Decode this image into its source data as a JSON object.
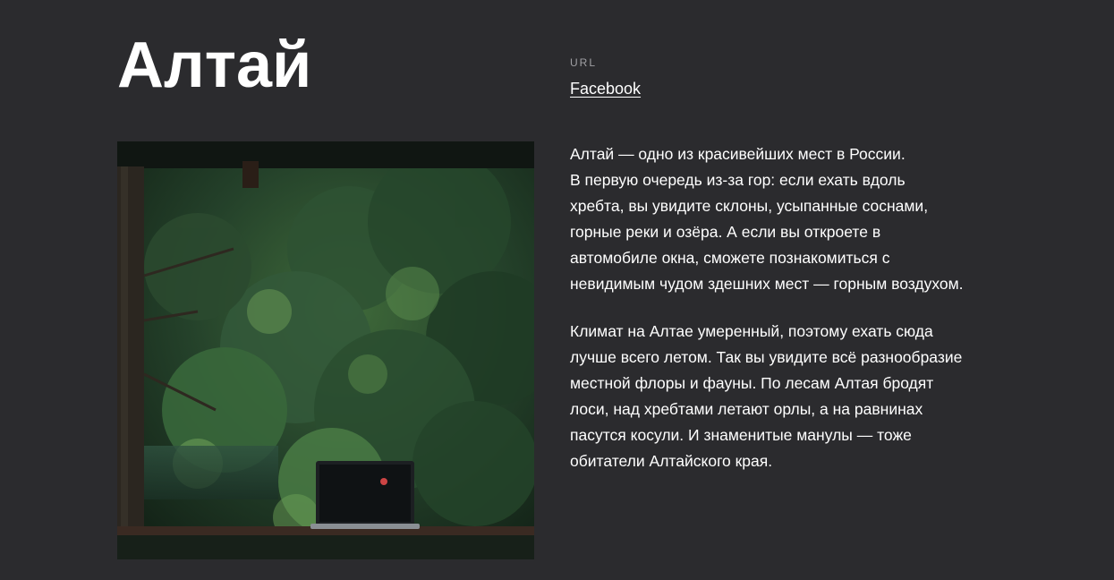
{
  "title": "Алтай",
  "link": {
    "label": "URL",
    "text": "Facebook"
  },
  "image": {
    "alt": "Алтай"
  },
  "paragraphs": [
    "Алтай — одно из красивейших мест в России.\nВ первую очередь из-за гор: если ехать вдоль\nхребта, вы увидите склоны, усыпанные соснами,\nгорные реки и озёра. А если вы откроете в\nавтомобиле окна, сможете познакомиться с\nневидимым чудом здешних мест — горным воздухом.",
    "Климат на Алтае умеренный, поэтому ехать сюда\nлучше всего летом. Так вы увидите всё разнообразие\nместной флоры и фауны. По лесам Алтая бродят\nлоси, над хребтами летают орлы, а на равнинах\nпасутся косули. И знаменитые манулы — тоже\nобитатели Алтайского края."
  ],
  "colors": {
    "background": "#2b2b2e",
    "text": "#ffffff",
    "muted": "#a0a0a4"
  }
}
